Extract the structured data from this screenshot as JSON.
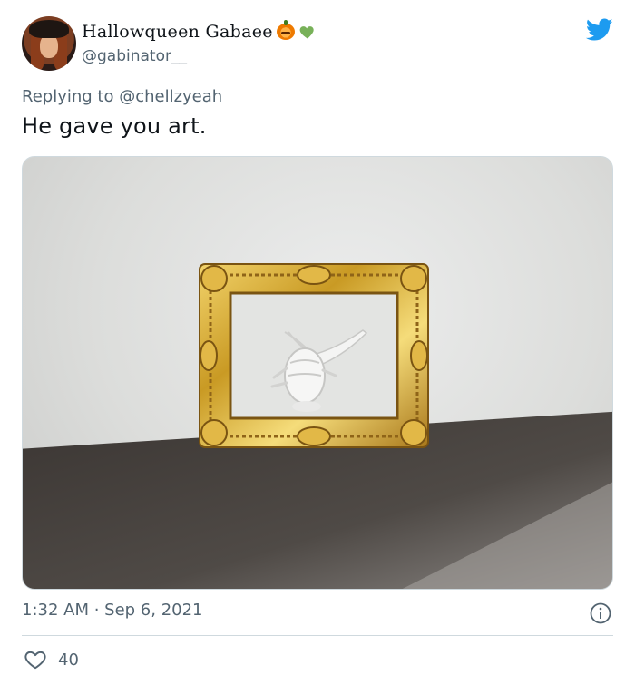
{
  "tweet": {
    "author": {
      "display_name": "Hallowqueen Gabaee",
      "handle": "@gabinator__",
      "emoji_icons": [
        "pumpkin-icon",
        "green-heart-icon"
      ]
    },
    "replying_to_prefix": "Replying to ",
    "replying_to_handle": "@chellzyeah",
    "text": "He gave you art.",
    "timestamp": "1:32 AM · Sep 6, 2021",
    "likes": "40"
  },
  "colors": {
    "twitter_blue": "#1d9bf0",
    "secondary_text": "#536471",
    "primary_text": "#0f1419",
    "green_heart": "#78b159",
    "pumpkin_orange": "#ee7a00"
  },
  "icons": {
    "brand": "twitter-bird-icon",
    "info": "info-icon",
    "like": "heart-outline-icon"
  }
}
